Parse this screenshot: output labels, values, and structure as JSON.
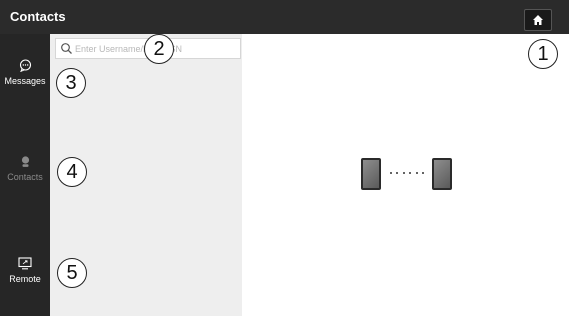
{
  "header": {
    "title": "Contacts",
    "home_icon": "home-icon"
  },
  "rail": {
    "items": [
      {
        "label": "Messages",
        "icon": "chat-bubble-icon",
        "active": true
      },
      {
        "label": "Contacts",
        "icon": "contact-person-icon",
        "active": false
      },
      {
        "label": "Remote",
        "icon": "remote-screen-icon",
        "active": true
      }
    ]
  },
  "search": {
    "placeholder": "Enter Username/Name/SN",
    "value": ""
  },
  "illustration": {
    "description_icons": [
      "tablet-icon",
      "tablet-icon"
    ]
  },
  "callouts": [
    "1",
    "2",
    "3",
    "4",
    "5"
  ],
  "colors": {
    "topbar": "#2b2b2b",
    "rail": "#262626",
    "list_panel": "#eeeeee",
    "detail": "#ffffff"
  }
}
